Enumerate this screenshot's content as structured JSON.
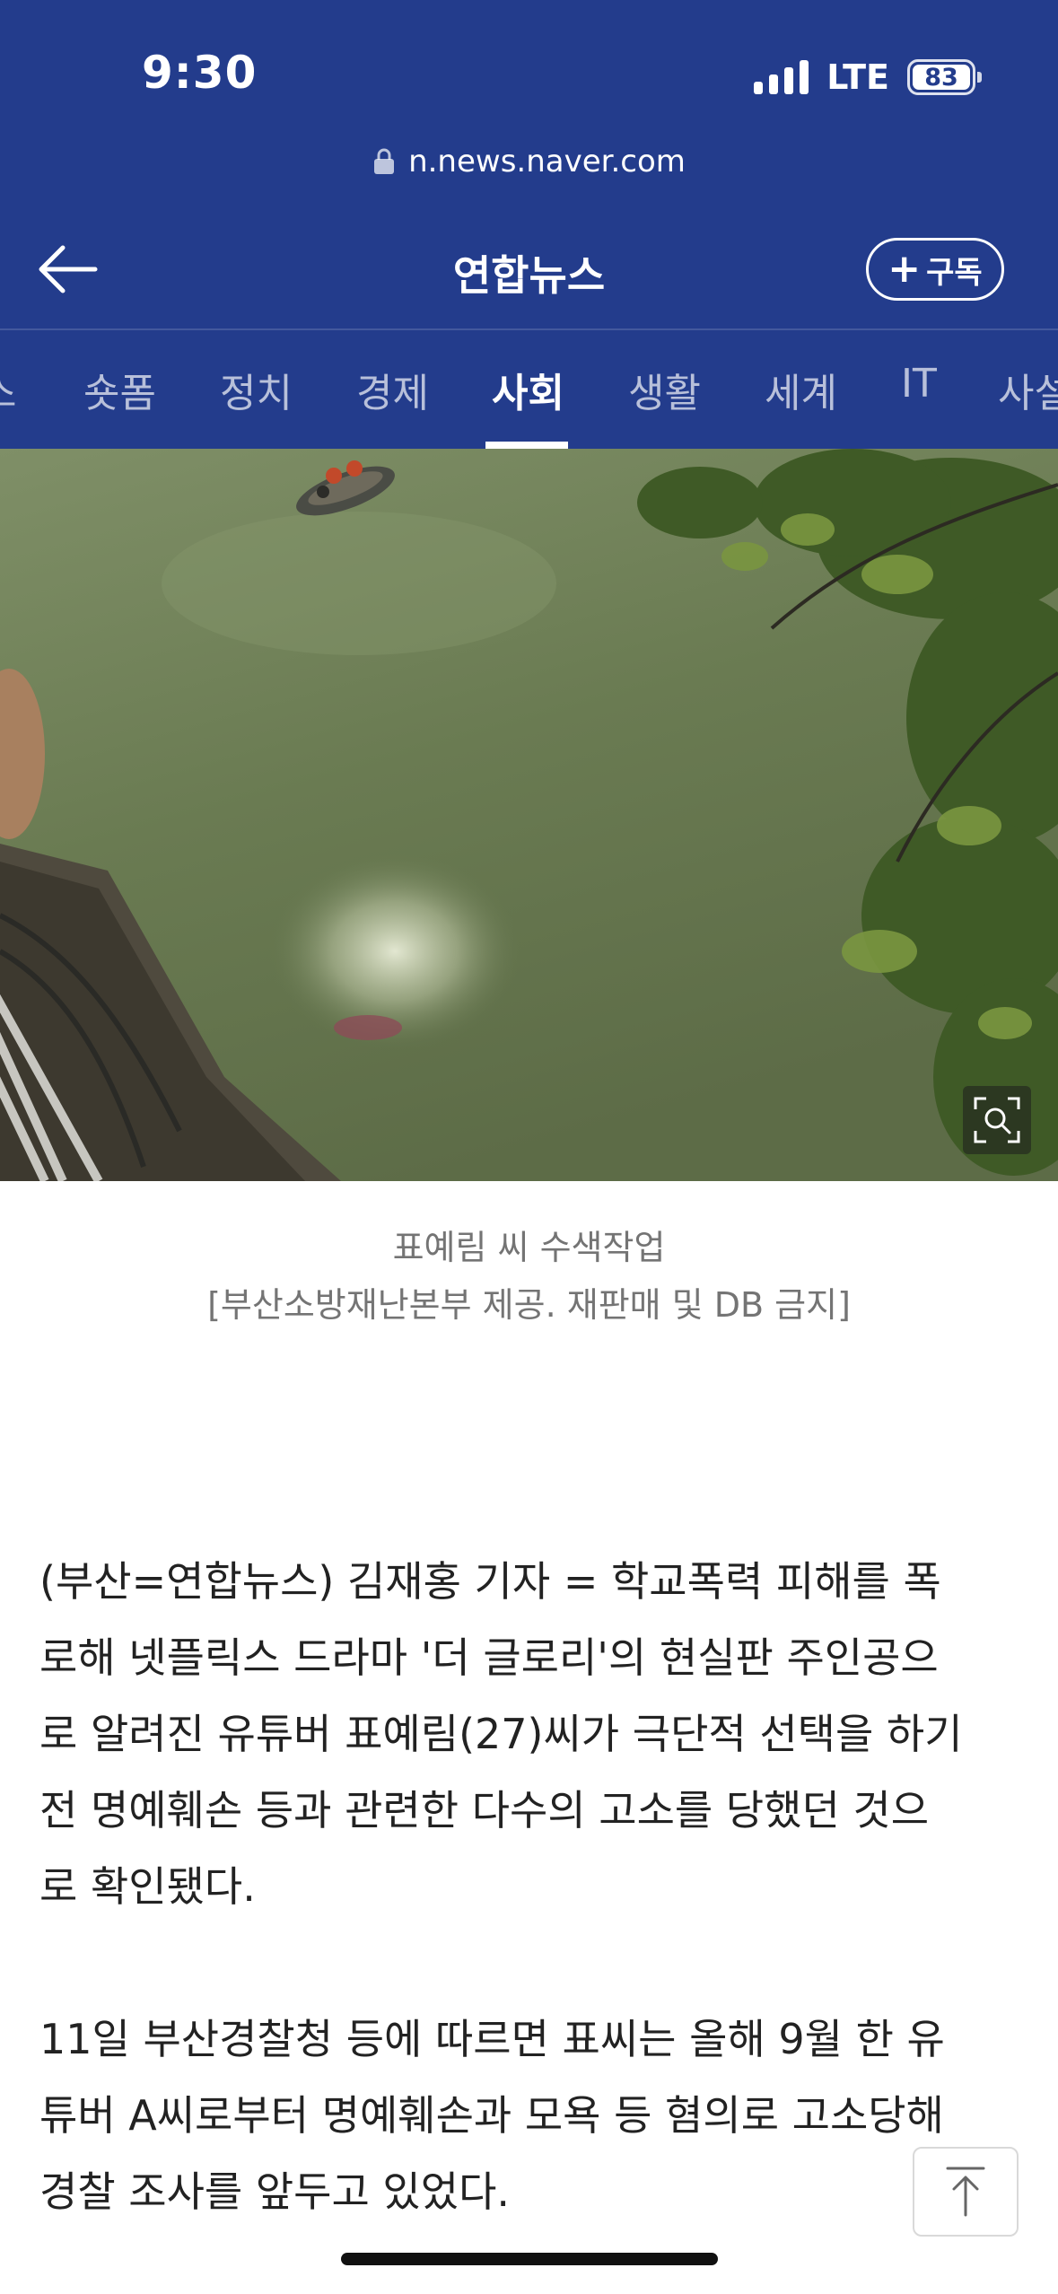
{
  "status_bar": {
    "time": "9:30",
    "network": "LTE",
    "battery": "83",
    "icons": [
      "signal-icon",
      "battery-icon"
    ]
  },
  "browser": {
    "url": "n.news.naver.com",
    "icons": [
      "lock-icon"
    ]
  },
  "header": {
    "press_name": "연합뉴스",
    "subscribe_label": "구독",
    "subscribe_plus": "+",
    "icons": [
      "back-arrow-icon",
      "plus-icon"
    ]
  },
  "tabs": [
    {
      "label": "스",
      "active": false
    },
    {
      "label": "숏폼",
      "active": false
    },
    {
      "label": "정치",
      "active": false
    },
    {
      "label": "경제",
      "active": false
    },
    {
      "label": "사회",
      "active": true
    },
    {
      "label": "생활",
      "active": false
    },
    {
      "label": "세계",
      "active": false
    },
    {
      "label": "IT",
      "active": false
    },
    {
      "label": "사설",
      "active": false
    }
  ],
  "photo": {
    "icons": [
      "zoom-icon"
    ]
  },
  "caption": {
    "line1": "표예림 씨 수색작업",
    "line2": "[부산소방재난본부 제공. 재판매 및 DB 금지]"
  },
  "article": {
    "paragraphs": [
      "(부산=연합뉴스) 김재홍 기자 = 학교폭력 피해를 폭\n로해 넷플릭스 드라마 '더 글로리'의 현실판 주인공으\n로 알려진 유튜버 표예림(27)씨가 극단적 선택을 하기\n전 명예훼손 등과 관련한 다수의 고소를 당했던 것으\n로 확인됐다.",
      "11일 부산경찰청 등에 따르면 표씨는 올해 9월 한 유\n튜버 A씨로부터 명예훼손과 모욕 등 혐의로 고소당해\n경찰 조사를 앞두고 있었다."
    ]
  },
  "floating": {
    "icons": [
      "arrow-up-icon"
    ]
  },
  "colors": {
    "header_bg": "#233c8c",
    "body_text": "#222222",
    "caption_text": "#747474"
  }
}
